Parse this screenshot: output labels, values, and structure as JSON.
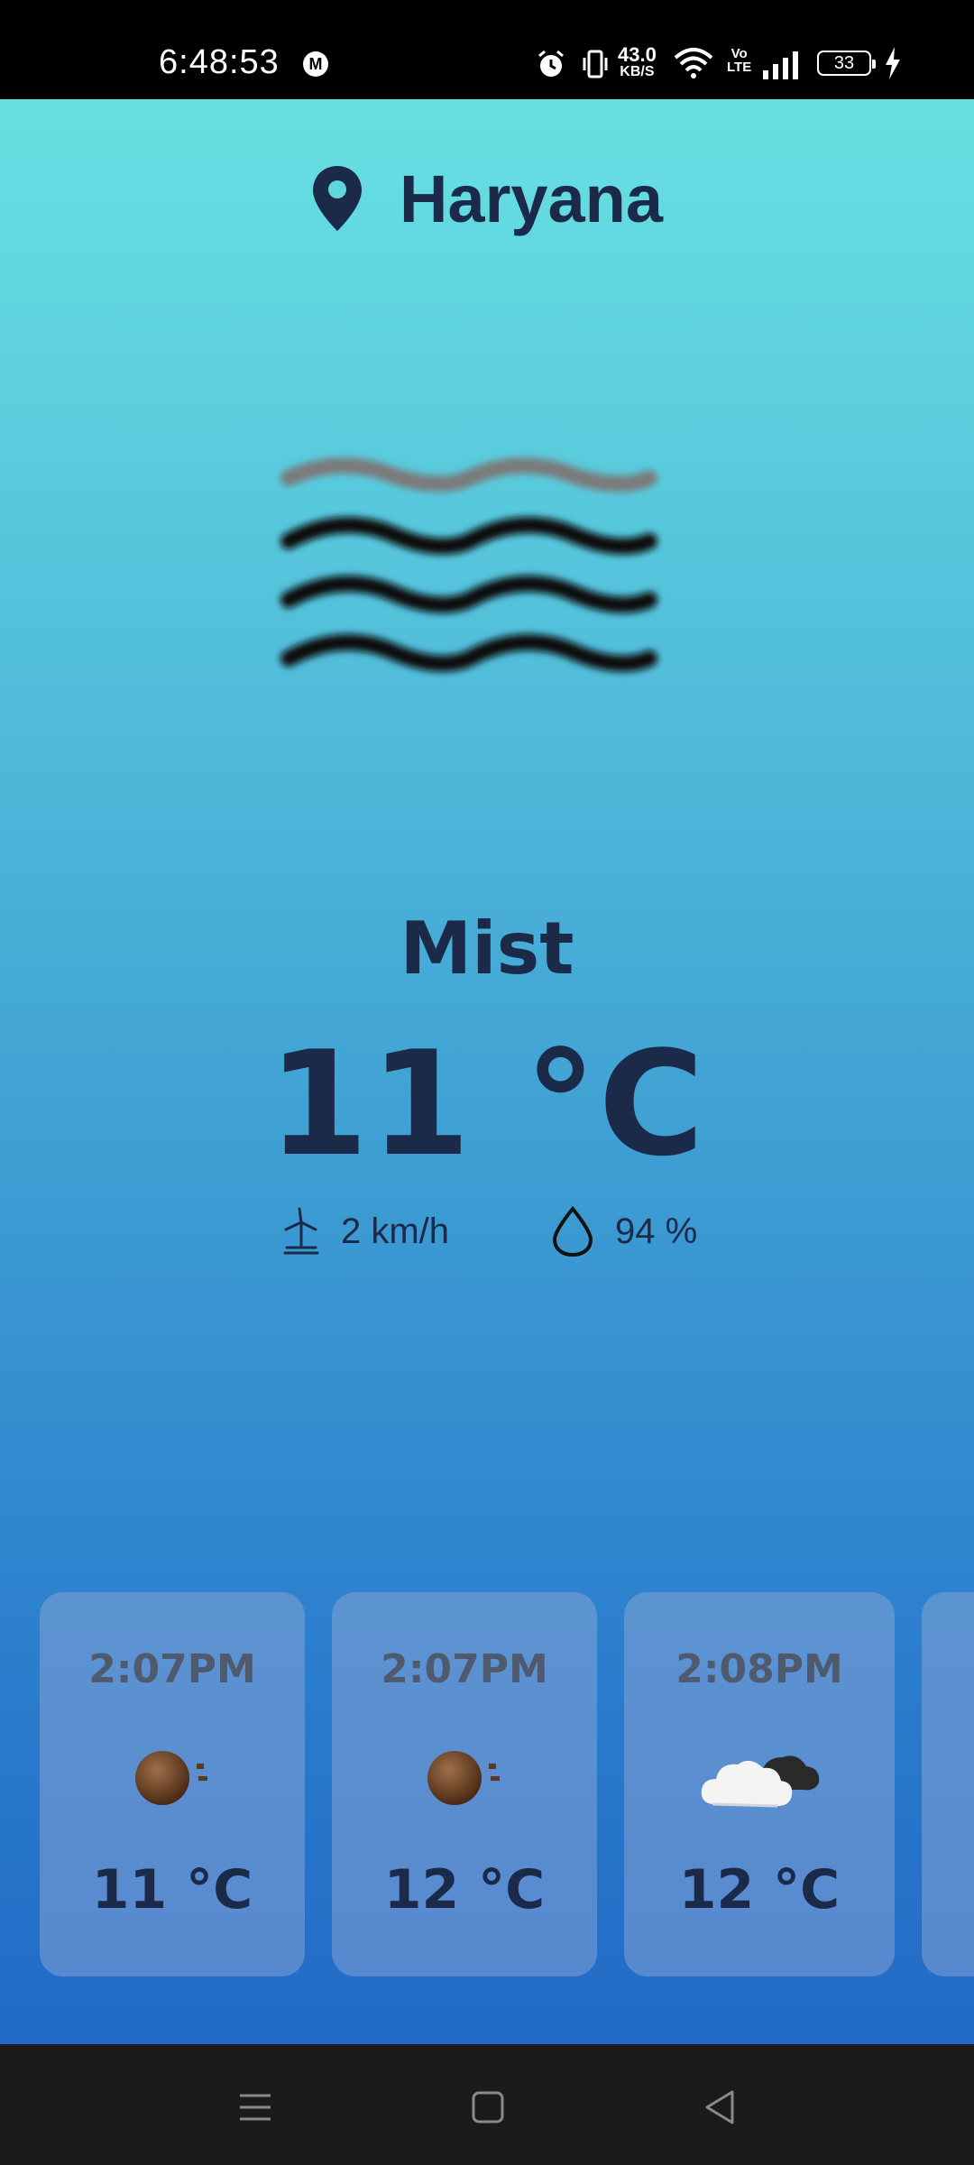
{
  "status_bar": {
    "time": "6:48:53",
    "notification_badge": "M",
    "net_speed_value": "43.0",
    "net_speed_unit": "KB/S",
    "volte_top": "Vo",
    "volte_bottom": "LTE",
    "battery": "33"
  },
  "location": {
    "icon": "location-pin-icon",
    "name": "Haryana"
  },
  "current": {
    "icon": "mist-icon",
    "condition": "Mist",
    "temperature": "11 °C",
    "wind": "2 km/h",
    "humidity": "94 %"
  },
  "forecast": [
    {
      "time": "2:07PM",
      "icon": "haze-icon",
      "temp": "11 °C"
    },
    {
      "time": "2:07PM",
      "icon": "haze-icon",
      "temp": "12 °C"
    },
    {
      "time": "2:08PM",
      "icon": "cloud-icon",
      "temp": "12 °C"
    }
  ],
  "colors": {
    "text_dark": "#1c2a4a",
    "gradient_top": "#6be6e3",
    "gradient_bottom": "#1f64c4"
  }
}
